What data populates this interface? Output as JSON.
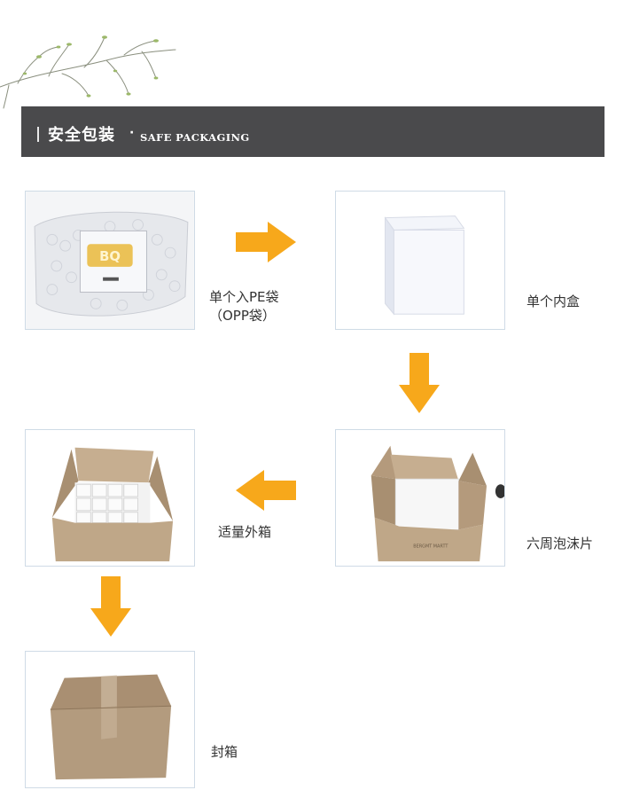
{
  "header": {
    "title_cn": "安全包装",
    "separator": "·",
    "title_en": "SAFE PACKAGING"
  },
  "steps": [
    {
      "label_line1": "单个入PE袋",
      "label_line2": "（OPP袋）",
      "image_icon": "bubble-bag-photo"
    },
    {
      "label_line1": "单个内盒",
      "image_icon": "white-inner-box-photo"
    },
    {
      "label_line1": "六周泡沫片",
      "image_icon": "foam-lined-carton-photo"
    },
    {
      "label_line1": "适量外箱",
      "image_icon": "carton-with-boxes-photo"
    },
    {
      "label_line1": "封箱",
      "image_icon": "sealed-carton-photo"
    }
  ],
  "colors": {
    "header_bg": "#4a4a4c",
    "arrow": "#f7a81b",
    "frame_border": "#cfdbe6",
    "cardboard": "#b8a083"
  }
}
